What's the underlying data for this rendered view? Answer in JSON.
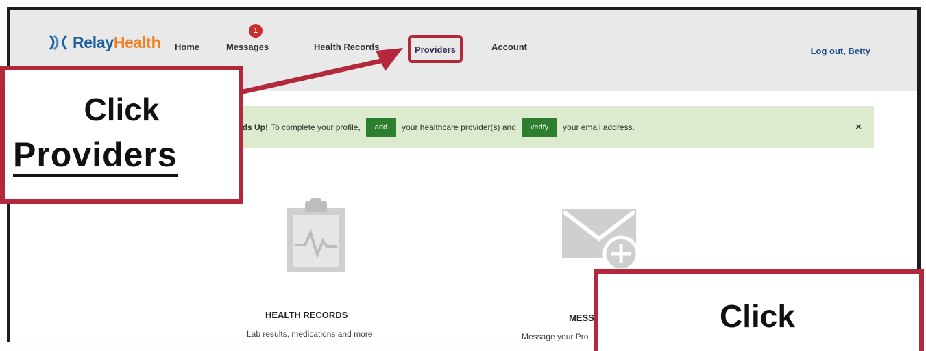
{
  "brand": {
    "relay": "Relay",
    "health": "Health"
  },
  "nav": {
    "home": "Home",
    "messages": "Messages",
    "messages_badge": "1",
    "health_records": "Health Records",
    "providers": "Providers",
    "account": "Account",
    "logout": "Log out, Betty"
  },
  "alert": {
    "strong": "ads Up!",
    "text1": "To complete your profile,",
    "add_button": "add",
    "text2": "your healthcare provider(s) and",
    "verify_button": "verify",
    "text3": "your email address.",
    "close": "×"
  },
  "cards": {
    "records_title": "HEALTH RECORDS",
    "records_sub": "Lab results, medications and more",
    "messages_title": "MESS",
    "messages_sub": "Message your Pro"
  },
  "callouts": {
    "providers_line1": "Click",
    "providers_line2": "Providers",
    "bottom_line1": "Click"
  },
  "colors": {
    "accent_red": "#b3283b",
    "alert_green_bg": "#dcebcd",
    "button_green": "#2d7f2f",
    "badge_red": "#c7302f",
    "brand_blue": "#1e5f9e",
    "brand_orange": "#f07f22"
  },
  "icons": {
    "logo": "relayhealth-logo-icon",
    "records": "clipboard-heartbeat-icon",
    "messages": "envelope-plus-icon"
  }
}
